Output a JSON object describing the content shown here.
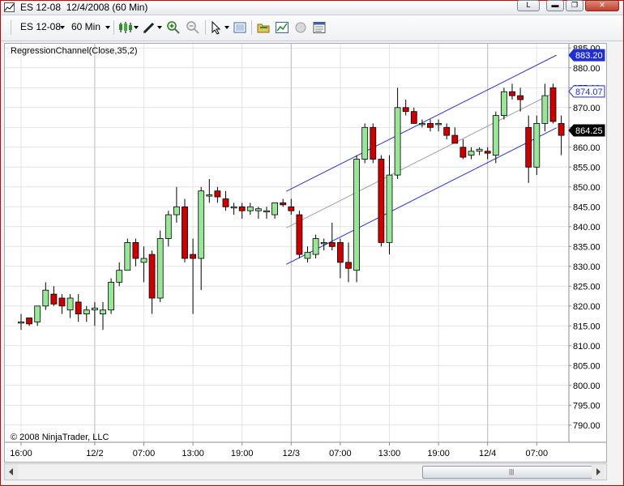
{
  "window": {
    "title": "ES 12-08  12/4/2008 (60 Min)",
    "buttons": {
      "help": "L"
    }
  },
  "toolbar": {
    "instrument": "ES 12-08",
    "interval": "60 Min",
    "icons": [
      "candlestick-style-icon",
      "draw-pencil-icon",
      "zoom-in-icon",
      "zoom-out-icon",
      "cursor-icon",
      "data-box-icon",
      "folder-icon",
      "indicator-icon",
      "strategy-icon",
      "properties-icon"
    ]
  },
  "chart": {
    "indicator_label": "RegressionChannel(Close,35,2)",
    "copyright": "© 2008 NinjaTrader, LLC",
    "colors": {
      "up": "#99e699",
      "down": "#cc0000",
      "channel": "#2a35c8",
      "midline": "#a0a0a0",
      "badge": "#1f2fd0",
      "price_badge": "#000000"
    },
    "badges": [
      {
        "text": "883.20",
        "value": 883.2,
        "type": "upper"
      },
      {
        "text": "874.07",
        "value": 874.07,
        "type": "mid"
      },
      {
        "text": "864.25",
        "value": 864.25,
        "type": "last"
      }
    ]
  },
  "chart_data": {
    "type": "candlestick",
    "y_ticks": [
      "885.00",
      "880.00",
      "875.00",
      "870.00",
      "865.00",
      "860.00",
      "855.00",
      "850.00",
      "845.00",
      "840.00",
      "835.00",
      "830.00",
      "825.00",
      "820.00",
      "815.00",
      "810.00",
      "805.00",
      "800.00",
      "795.00",
      "790.00"
    ],
    "y_tick_values": [
      885,
      880,
      875,
      870,
      865,
      860,
      855,
      850,
      845,
      840,
      835,
      830,
      825,
      820,
      815,
      810,
      805,
      800,
      795,
      790
    ],
    "x_ticks": [
      "16:00",
      "12/2",
      "07:00",
      "13:00",
      "19:00",
      "12/3",
      "07:00",
      "13:00",
      "19:00",
      "12/4",
      "07:00"
    ],
    "x_tick_bars": [
      0,
      9,
      15,
      21,
      27,
      33,
      39,
      45,
      51,
      57,
      63
    ],
    "ylim": [
      787,
      887
    ],
    "grid": true,
    "candles": [
      {
        "o": 816,
        "h": 818,
        "l": 814,
        "c": 816
      },
      {
        "o": 817,
        "h": 817,
        "l": 815,
        "c": 815.5
      },
      {
        "o": 816,
        "h": 820,
        "l": 815,
        "c": 820
      },
      {
        "o": 820,
        "h": 826,
        "l": 819,
        "c": 824
      },
      {
        "o": 823,
        "h": 825,
        "l": 820,
        "c": 820.5
      },
      {
        "o": 822,
        "h": 823,
        "l": 818,
        "c": 820
      },
      {
        "o": 819,
        "h": 823,
        "l": 817,
        "c": 822
      },
      {
        "o": 821,
        "h": 823,
        "l": 816,
        "c": 818
      },
      {
        "o": 818,
        "h": 820,
        "l": 816,
        "c": 819
      },
      {
        "o": 819,
        "h": 821,
        "l": 815,
        "c": 819.5
      },
      {
        "o": 818,
        "h": 821,
        "l": 814,
        "c": 819
      },
      {
        "o": 819,
        "h": 827,
        "l": 818,
        "c": 826
      },
      {
        "o": 826,
        "h": 831,
        "l": 825,
        "c": 829
      },
      {
        "o": 829,
        "h": 837,
        "l": 829,
        "c": 836
      },
      {
        "o": 836,
        "h": 837,
        "l": 830,
        "c": 832
      },
      {
        "o": 831,
        "h": 835,
        "l": 826,
        "c": 832
      },
      {
        "o": 833,
        "h": 834,
        "l": 818,
        "c": 822
      },
      {
        "o": 822,
        "h": 839,
        "l": 821,
        "c": 837
      },
      {
        "o": 837,
        "h": 844,
        "l": 835,
        "c": 843
      },
      {
        "o": 843,
        "h": 850,
        "l": 841,
        "c": 845
      },
      {
        "o": 845,
        "h": 847,
        "l": 831,
        "c": 832
      },
      {
        "o": 833,
        "h": 837,
        "l": 818,
        "c": 832
      },
      {
        "o": 832,
        "h": 850,
        "l": 824,
        "c": 849
      },
      {
        "o": 848,
        "h": 852,
        "l": 846,
        "c": 848
      },
      {
        "o": 849,
        "h": 850,
        "l": 846,
        "c": 847.5
      },
      {
        "o": 847,
        "h": 849,
        "l": 844,
        "c": 845
      },
      {
        "o": 845,
        "h": 846,
        "l": 843,
        "c": 845
      },
      {
        "o": 845,
        "h": 846,
        "l": 842,
        "c": 844
      },
      {
        "o": 844,
        "h": 846,
        "l": 843,
        "c": 845
      },
      {
        "o": 844,
        "h": 845,
        "l": 842,
        "c": 844.5
      },
      {
        "o": 844,
        "h": 845,
        "l": 842,
        "c": 844
      },
      {
        "o": 843,
        "h": 846,
        "l": 842,
        "c": 846
      },
      {
        "o": 846,
        "h": 847,
        "l": 845,
        "c": 845.5
      },
      {
        "o": 845,
        "h": 847,
        "l": 843,
        "c": 844
      },
      {
        "o": 843,
        "h": 844,
        "l": 832,
        "c": 833
      },
      {
        "o": 832,
        "h": 835,
        "l": 831,
        "c": 833.5
      },
      {
        "o": 833,
        "h": 838,
        "l": 832,
        "c": 837
      },
      {
        "o": 836,
        "h": 837,
        "l": 834,
        "c": 836
      },
      {
        "o": 836,
        "h": 841,
        "l": 834,
        "c": 835
      },
      {
        "o": 836,
        "h": 837,
        "l": 827,
        "c": 831
      },
      {
        "o": 831,
        "h": 836,
        "l": 826,
        "c": 829.5
      },
      {
        "o": 829,
        "h": 858,
        "l": 826,
        "c": 857
      },
      {
        "o": 857,
        "h": 866,
        "l": 856,
        "c": 865
      },
      {
        "o": 865,
        "h": 866,
        "l": 856,
        "c": 857
      },
      {
        "o": 857,
        "h": 858,
        "l": 835,
        "c": 836
      },
      {
        "o": 836,
        "h": 858,
        "l": 833,
        "c": 853
      },
      {
        "o": 853,
        "h": 875,
        "l": 852,
        "c": 870
      },
      {
        "o": 870,
        "h": 872,
        "l": 868,
        "c": 869
      },
      {
        "o": 869,
        "h": 870,
        "l": 866,
        "c": 866
      },
      {
        "o": 866,
        "h": 867,
        "l": 865,
        "c": 866
      },
      {
        "o": 866,
        "h": 867,
        "l": 864,
        "c": 865
      },
      {
        "o": 866,
        "h": 867,
        "l": 864,
        "c": 866
      },
      {
        "o": 865,
        "h": 866,
        "l": 862,
        "c": 863
      },
      {
        "o": 863,
        "h": 865,
        "l": 861,
        "c": 861
      },
      {
        "o": 860,
        "h": 862,
        "l": 857,
        "c": 857.5
      },
      {
        "o": 858,
        "h": 860,
        "l": 857,
        "c": 859
      },
      {
        "o": 859,
        "h": 860,
        "l": 858,
        "c": 859.5
      },
      {
        "o": 859,
        "h": 860,
        "l": 857,
        "c": 858.5
      },
      {
        "o": 858,
        "h": 869,
        "l": 856,
        "c": 868
      },
      {
        "o": 868,
        "h": 875,
        "l": 867,
        "c": 874
      },
      {
        "o": 874,
        "h": 876,
        "l": 872,
        "c": 873
      },
      {
        "o": 873,
        "h": 875,
        "l": 869,
        "c": 872
      },
      {
        "o": 865,
        "h": 868,
        "l": 851,
        "c": 855
      },
      {
        "o": 855,
        "h": 868,
        "l": 853,
        "c": 866
      },
      {
        "o": 866,
        "h": 876,
        "l": 864,
        "c": 873
      },
      {
        "o": 875,
        "h": 876,
        "l": 866,
        "c": 866.5
      },
      {
        "o": 866,
        "h": 868,
        "l": 858,
        "c": 863
      }
    ],
    "channel": {
      "start_bar": 33,
      "end_bar": 66,
      "mid_start": 839.7,
      "mid_end": 874.07,
      "upper_start": 848.9,
      "upper_end": 883.2,
      "lower_start": 830.5,
      "lower_end": 864.9
    }
  }
}
